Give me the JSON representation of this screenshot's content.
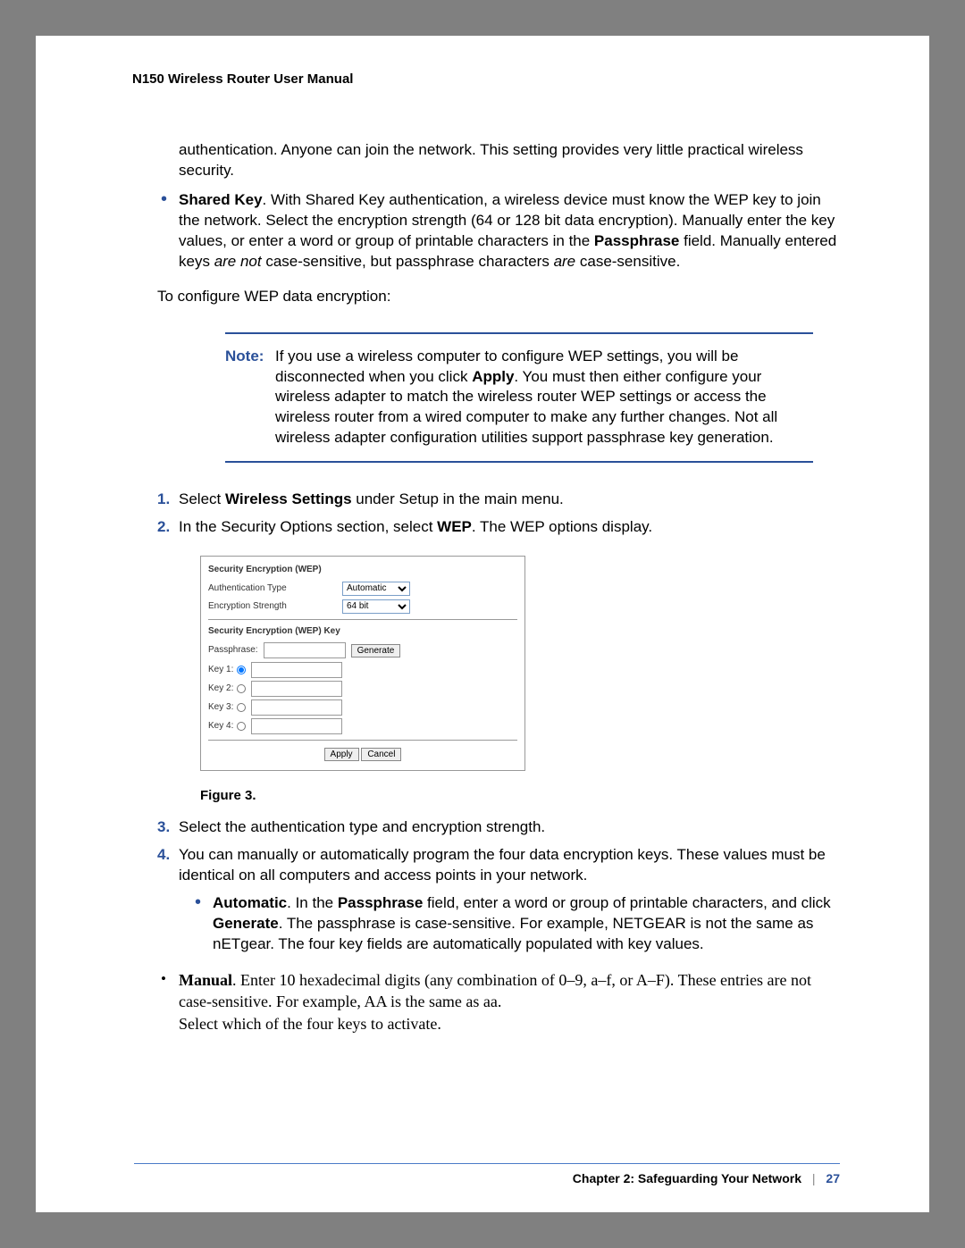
{
  "header": {
    "title": "N150 Wireless Router User Manual"
  },
  "continuation": "authentication. Anyone can join the network. This setting provides very little practical wireless security.",
  "sharedKey": {
    "label": "Shared Key",
    "text1": ". With Shared Key authentication, a wireless device must know the WEP key to join the network. Select the encryption strength (64 or 128 bit data encryption). Manually enter the key values, or enter a word or group of printable characters in the ",
    "passphrase": "Passphrase",
    "text2": " field. Manually entered keys ",
    "areNot": "are not",
    "text3": " case-sensitive, but passphrase characters ",
    "are": "are",
    "text4": " case-sensitive."
  },
  "leadIn": "To configure WEP data encryption:",
  "note": {
    "label": "Note:",
    "text1": "If you use a wireless computer to configure WEP settings, you will be disconnected when you click ",
    "apply": "Apply",
    "text2": ". You must then either configure your wireless adapter to match the wireless router WEP settings or access the wireless router from a wired computer to make any further changes. Not all wireless adapter configuration utilities support passphrase key generation."
  },
  "steps": {
    "s1": {
      "num": "1.",
      "a": "Select ",
      "b": "Wireless Settings",
      "c": " under Setup in the main menu."
    },
    "s2": {
      "num": "2.",
      "a": "In the Security Options section, select ",
      "b": "WEP",
      "c": ". The WEP options display."
    },
    "s3": {
      "num": "3.",
      "a": "Select the authentication type and encryption strength."
    },
    "s4": {
      "num": "4.",
      "a": "You can manually or automatically program the four data encryption keys. These values must be identical on all computers and access points in your network."
    }
  },
  "figureCaption": "Figure 3.",
  "auto": {
    "label": "Automatic",
    "a": ". In the ",
    "pass": "Passphrase",
    "b": " field, enter a word or group of printable characters, and click ",
    "gen": "Generate",
    "c": ". The passphrase is case-sensitive. For example, NETGEAR is not the same as nETgear. The four key fields are automatically populated with key values."
  },
  "manual": {
    "label": "Manual",
    "a": ". Enter 10 hexadecimal digits (any combination of 0–9, a–f, or A–F). These entries are not case-sensitive. For example, AA is the same as aa.",
    "b": "Select which of the four keys to activate."
  },
  "shot": {
    "sec1Title": "Security Encryption (WEP)",
    "authLabel": "Authentication Type",
    "authValue": "Automatic",
    "encLabel": "Encryption Strength",
    "encValue": "64 bit",
    "sec2Title": "Security Encryption (WEP) Key",
    "passLabel": "Passphrase:",
    "generate": "Generate",
    "key1": "Key 1:",
    "key2": "Key 2:",
    "key3": "Key 3:",
    "key4": "Key 4:",
    "apply": "Apply",
    "cancel": "Cancel"
  },
  "footer": {
    "chapter": "Chapter 2:  Safeguarding Your Network",
    "page": "27"
  }
}
